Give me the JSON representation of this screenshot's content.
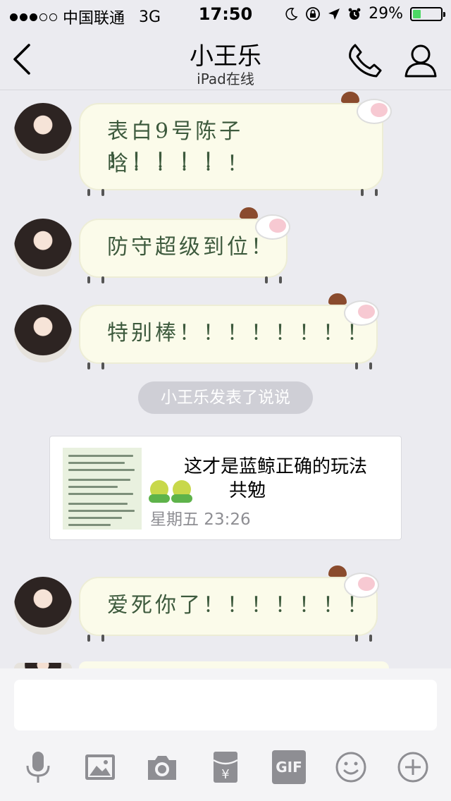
{
  "status_bar": {
    "carrier": "中国联通",
    "network": "3G",
    "time": "17:50",
    "battery_text": "29%",
    "battery_level": 0.29
  },
  "nav": {
    "title": "小王乐",
    "subtitle": "iPad在线"
  },
  "messages": [
    {
      "line1": "表白9号陈子晗！！！！！",
      "line2": "！！！！！"
    },
    {
      "line1": "防守超级到位！"
    },
    {
      "line1": "特别棒！！！！！！！！"
    },
    {
      "line1": "爱死你了！！！！！！！"
    }
  ],
  "system_notice": "小王乐发表了说说",
  "share_card": {
    "title": "这才是蓝鲸正确的玩法",
    "subtitle": "共勉",
    "date": "星期五 23:26"
  },
  "toolbar": {
    "gif_label": "GIF",
    "icons": [
      "microphone-icon",
      "image-icon",
      "camera-icon",
      "red-packet-icon",
      "gif-icon",
      "emoji-icon",
      "plus-icon"
    ]
  },
  "colors": {
    "bubble_bg": "#fbfbea",
    "bubble_text": "#3d5a3d",
    "battery_fill": "#4cd964",
    "background": "#ebebf0"
  }
}
